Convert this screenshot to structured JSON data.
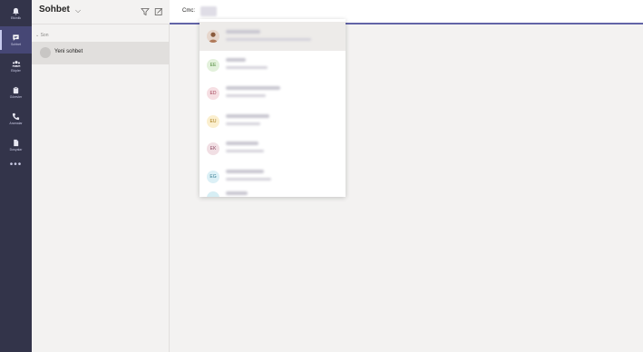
{
  "rail": {
    "items": [
      {
        "label": "Etkinlik",
        "icon": "bell-icon"
      },
      {
        "label": "Sohbet",
        "icon": "chat-icon"
      },
      {
        "label": "Ekipler",
        "icon": "teams-icon"
      },
      {
        "label": "Görevler",
        "icon": "tasks-icon"
      },
      {
        "label": "Aramalar",
        "icon": "phone-icon"
      },
      {
        "label": "Dosyalar",
        "icon": "files-icon"
      }
    ],
    "more": "•••"
  },
  "list": {
    "title": "Sohbet",
    "chevron": "⌵",
    "section": "⌄ Son",
    "new_chat": "Yeni sohbet"
  },
  "compose": {
    "to_label": "Cmc:"
  },
  "suggestions": [
    {
      "initials": "",
      "color": "#e6d6cc",
      "text_color": "#8a5a3c",
      "photo": true
    },
    {
      "initials": "EE",
      "color": "#e3f1dc",
      "text_color": "#4f8a3a"
    },
    {
      "initials": "ED",
      "color": "#f6dfe3",
      "text_color": "#a4455b"
    },
    {
      "initials": "EU",
      "color": "#fbefcf",
      "text_color": "#a67a17"
    },
    {
      "initials": "EK",
      "color": "#f1dfe4",
      "text_color": "#8e4a63"
    },
    {
      "initials": "EG",
      "color": "#dcf0f6",
      "text_color": "#3a7f95"
    },
    {
      "initials": "",
      "color": "#d6eef4",
      "text_color": "#3a7f95"
    }
  ],
  "colors": {
    "rail": "#33344a",
    "accent": "#6264a7"
  }
}
